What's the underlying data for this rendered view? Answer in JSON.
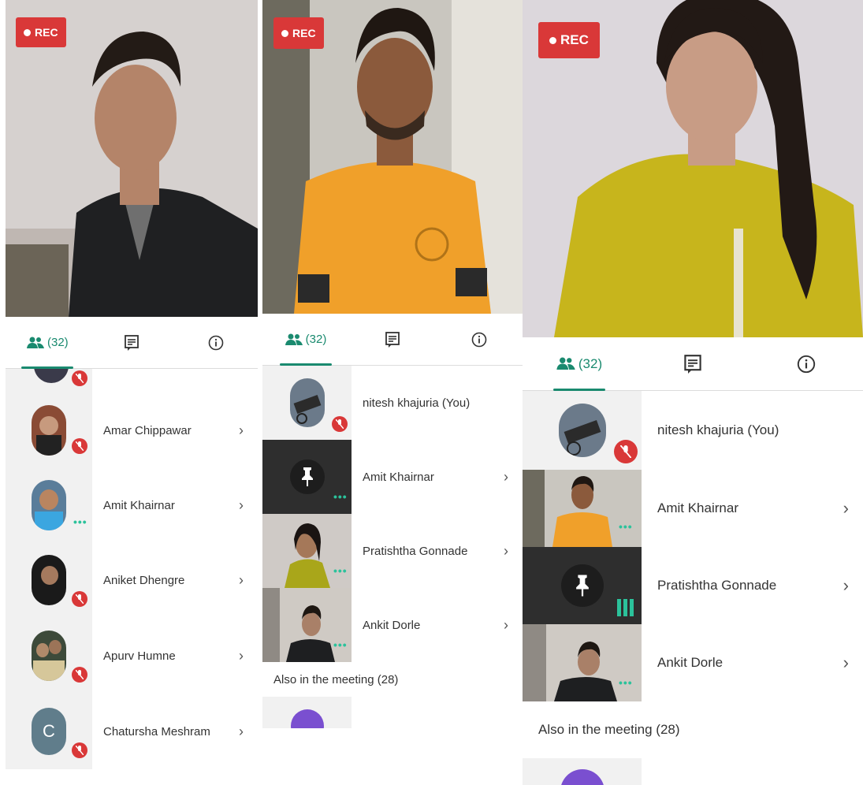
{
  "rec_label": "REC",
  "panels": [
    {
      "tabs": {
        "participants_count": "(32)"
      },
      "rows": [
        {
          "name": "Amar Chippawar"
        },
        {
          "name": "Amit Khairnar"
        },
        {
          "name": "Aniket Dhengre"
        },
        {
          "name": "Apurv Humne"
        },
        {
          "name": "Chatursha Meshram",
          "initial": "C"
        }
      ]
    },
    {
      "tabs": {
        "participants_count": "(32)"
      },
      "rows": [
        {
          "name": "nitesh khajuria (You)"
        },
        {
          "name": "Amit Khairnar"
        },
        {
          "name": "Pratishtha Gonnade"
        },
        {
          "name": "Ankit Dorle"
        }
      ],
      "also_label": "Also in the meeting (28)"
    },
    {
      "tabs": {
        "participants_count": "(32)"
      },
      "rows": [
        {
          "name": "nitesh khajuria (You)"
        },
        {
          "name": "Amit Khairnar"
        },
        {
          "name": "Pratishtha Gonnade"
        },
        {
          "name": "Ankit Dorle"
        }
      ],
      "also_label": "Also in the meeting (28)"
    }
  ],
  "colors": {
    "accent": "#1a8a6f",
    "rec": "#d93838",
    "avatar_purple": "#7a4fd0"
  },
  "icons": [
    "people-icon",
    "chat-icon",
    "info-icon",
    "mic-off-icon",
    "chevron-right-icon",
    "more-dots-icon",
    "pin-icon",
    "audio-bars-icon"
  ]
}
